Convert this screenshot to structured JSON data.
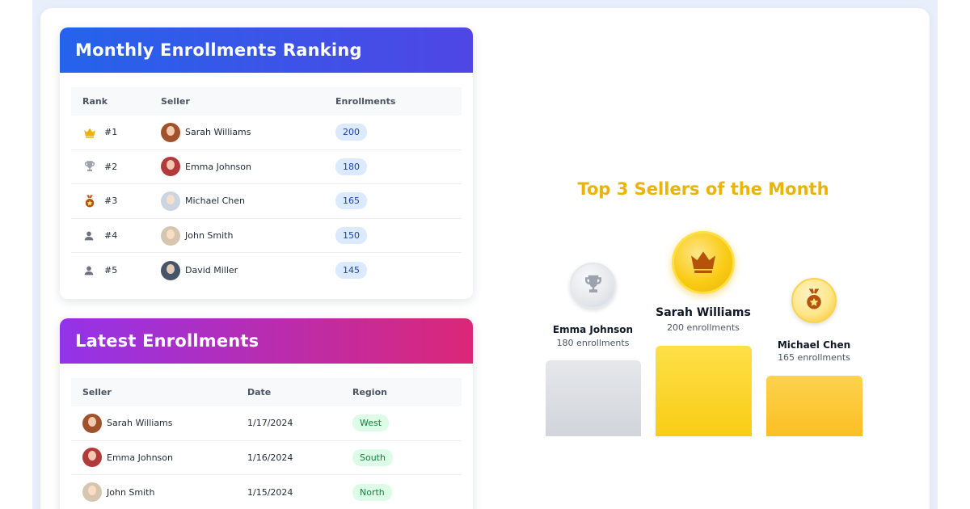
{
  "ranking": {
    "title": "Monthly Enrollments Ranking",
    "columns": {
      "rank": "Rank",
      "seller": "Seller",
      "enrollments": "Enrollments"
    },
    "rows": [
      {
        "rank": "#1",
        "icon": "crown-icon",
        "seller": "Sarah Williams",
        "enrollments": "200",
        "avatar_color": "#a0522d"
      },
      {
        "rank": "#2",
        "icon": "trophy-icon",
        "seller": "Emma Johnson",
        "enrollments": "180",
        "avatar_color": "#b23a3a"
      },
      {
        "rank": "#3",
        "icon": "medal-icon",
        "seller": "Michael Chen",
        "enrollments": "165",
        "avatar_color": "#cbd5e1"
      },
      {
        "rank": "#4",
        "icon": "user-icon",
        "seller": "John Smith",
        "enrollments": "150",
        "avatar_color": "#d6c6b0"
      },
      {
        "rank": "#5",
        "icon": "user-icon",
        "seller": "David Miller",
        "enrollments": "145",
        "avatar_color": "#475569"
      }
    ]
  },
  "latest": {
    "title": "Latest Enrollments",
    "columns": {
      "seller": "Seller",
      "date": "Date",
      "region": "Region"
    },
    "rows": [
      {
        "seller": "Sarah Williams",
        "date": "1/17/2024",
        "region": "West",
        "avatar_color": "#a0522d"
      },
      {
        "seller": "Emma Johnson",
        "date": "1/16/2024",
        "region": "South",
        "avatar_color": "#b23a3a"
      },
      {
        "seller": "John Smith",
        "date": "1/15/2024",
        "region": "North",
        "avatar_color": "#d6c6b0"
      }
    ]
  },
  "podium": {
    "title": "Top 3 Sellers of the Month",
    "first": {
      "name": "Sarah Williams",
      "sub": "200 enrollments",
      "icon": "crown-icon"
    },
    "second": {
      "name": "Emma Johnson",
      "sub": "180 enrollments",
      "icon": "trophy-icon"
    },
    "third": {
      "name": "Michael Chen",
      "sub": "165 enrollments",
      "icon": "medal-icon"
    }
  },
  "colors": {
    "ranking_header_start": "#2563eb",
    "ranking_header_end": "#4f46e5",
    "latest_header_start": "#9333ea",
    "latest_header_end": "#db2777",
    "gold": "#eab308",
    "silver": "#9ca3af",
    "bronze": "#b45309"
  }
}
